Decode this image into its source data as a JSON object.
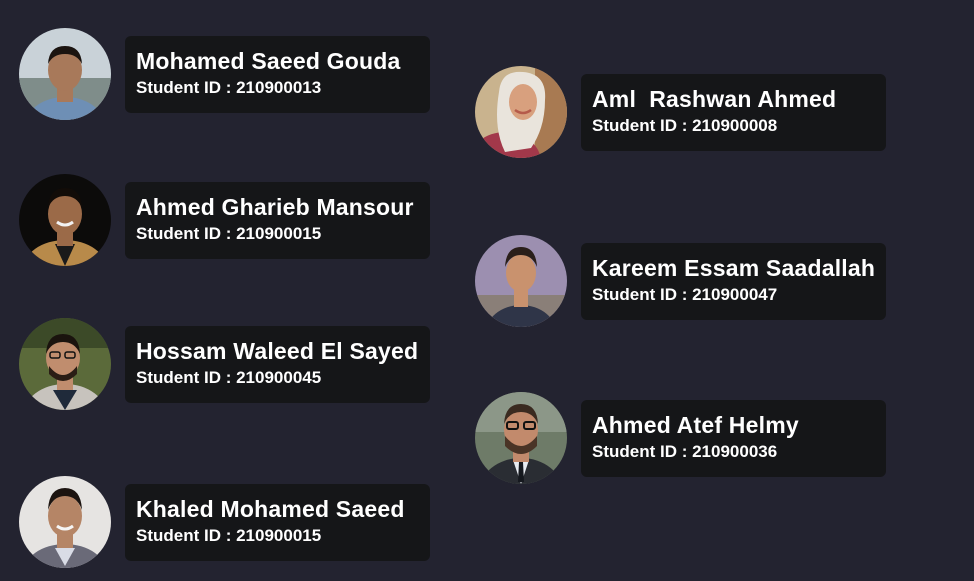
{
  "members": [
    {
      "name": "Mohamed Saeed Gouda",
      "id_label": "Student ID : 210900013",
      "avatar": {
        "bg": "#c9d2d8",
        "skin": "#a8795a",
        "hair": "#1b1410",
        "shirt": "#6e8fb5"
      }
    },
    {
      "name": "Ahmed Gharieb Mansour",
      "id_label": "Student ID : 210900015",
      "avatar": {
        "bg": "#0c0b0a",
        "skin": "#9b6a48",
        "hair": "#120c08",
        "shirt": "#b88a4a"
      }
    },
    {
      "name": "Hossam Waleed El Sayed",
      "id_label": "Student ID : 210900045",
      "avatar": {
        "bg": "#5b6a3a",
        "skin": "#c08d6e",
        "hair": "#1a130e",
        "shirt": "#c7c3bd"
      }
    },
    {
      "name": "Khaled Mohamed Saeed",
      "id_label": "Student ID : 210900015",
      "avatar": {
        "bg": "#e6e4e2",
        "skin": "#b58566",
        "hair": "#1c1410",
        "shirt": "#6a6a78"
      }
    },
    {
      "name": "Aml  Rashwan Ahmed",
      "id_label": "Student ID : 210900008",
      "avatar": {
        "bg": "#c9b38e",
        "skin": "#d8a07e",
        "hair": "#e9e4dc",
        "shirt": "#a2384a"
      }
    },
    {
      "name": "Kareem Essam Saadallah",
      "id_label": "Student ID : 210900047",
      "avatar": {
        "bg": "#9c8fb0",
        "skin": "#c9926e",
        "hair": "#2a1f1a",
        "shirt": "#2f3548"
      }
    },
    {
      "name": "Ahmed Atef Helmy",
      "id_label": "Student ID : 210900036",
      "avatar": {
        "bg": "#6e7b68",
        "skin": "#c28a6c",
        "hair": "#3a2a20",
        "shirt": "#2a2d33"
      }
    }
  ]
}
